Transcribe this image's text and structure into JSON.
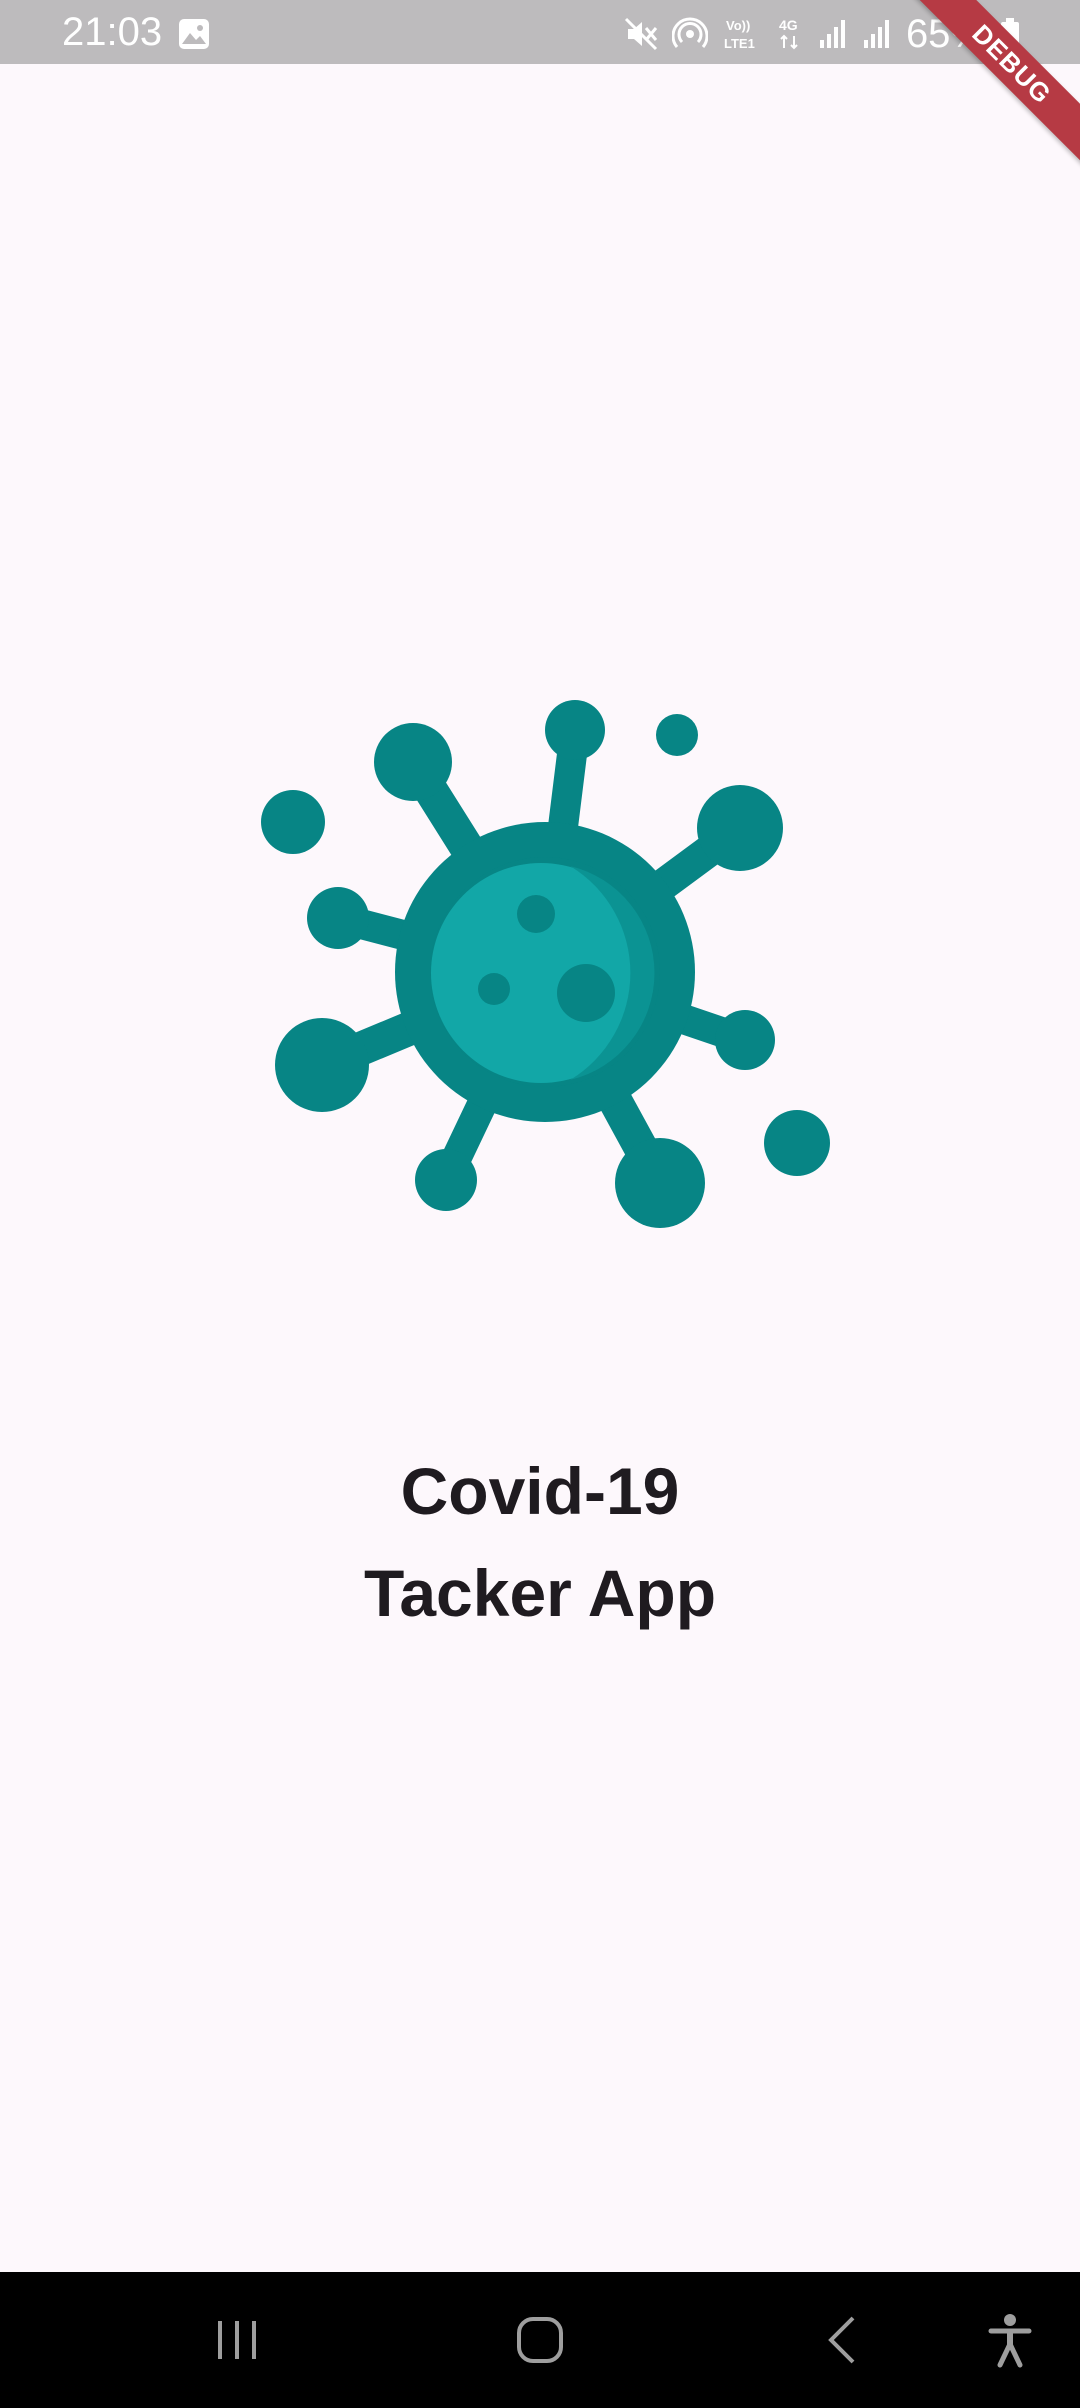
{
  "status_bar": {
    "time": "21:03",
    "battery_percent": "65%",
    "icons": [
      "gallery-icon",
      "mute-icon",
      "hotspot-icon",
      "volte-icon",
      "4g-icon",
      "signal-icon",
      "signal-icon",
      "battery-icon"
    ]
  },
  "debug_banner": {
    "label": "DEBUG",
    "color": "#b63a44"
  },
  "splash": {
    "logo_icon": "virus-icon",
    "title_line1": "Covid-19",
    "title_line2": "Tacker App"
  },
  "nav_bar": {
    "recent_icon": "recent-apps-icon",
    "home_icon": "home-icon",
    "back_icon": "back-icon",
    "accessibility_icon": "accessibility-icon"
  },
  "colors": {
    "background": "#fdf8fc",
    "status_bar": "#bdbbbd",
    "virus_dark": "#078585",
    "virus_light": "#12a7a7",
    "title_text": "#1f1b20",
    "nav_bar": "#000000"
  }
}
